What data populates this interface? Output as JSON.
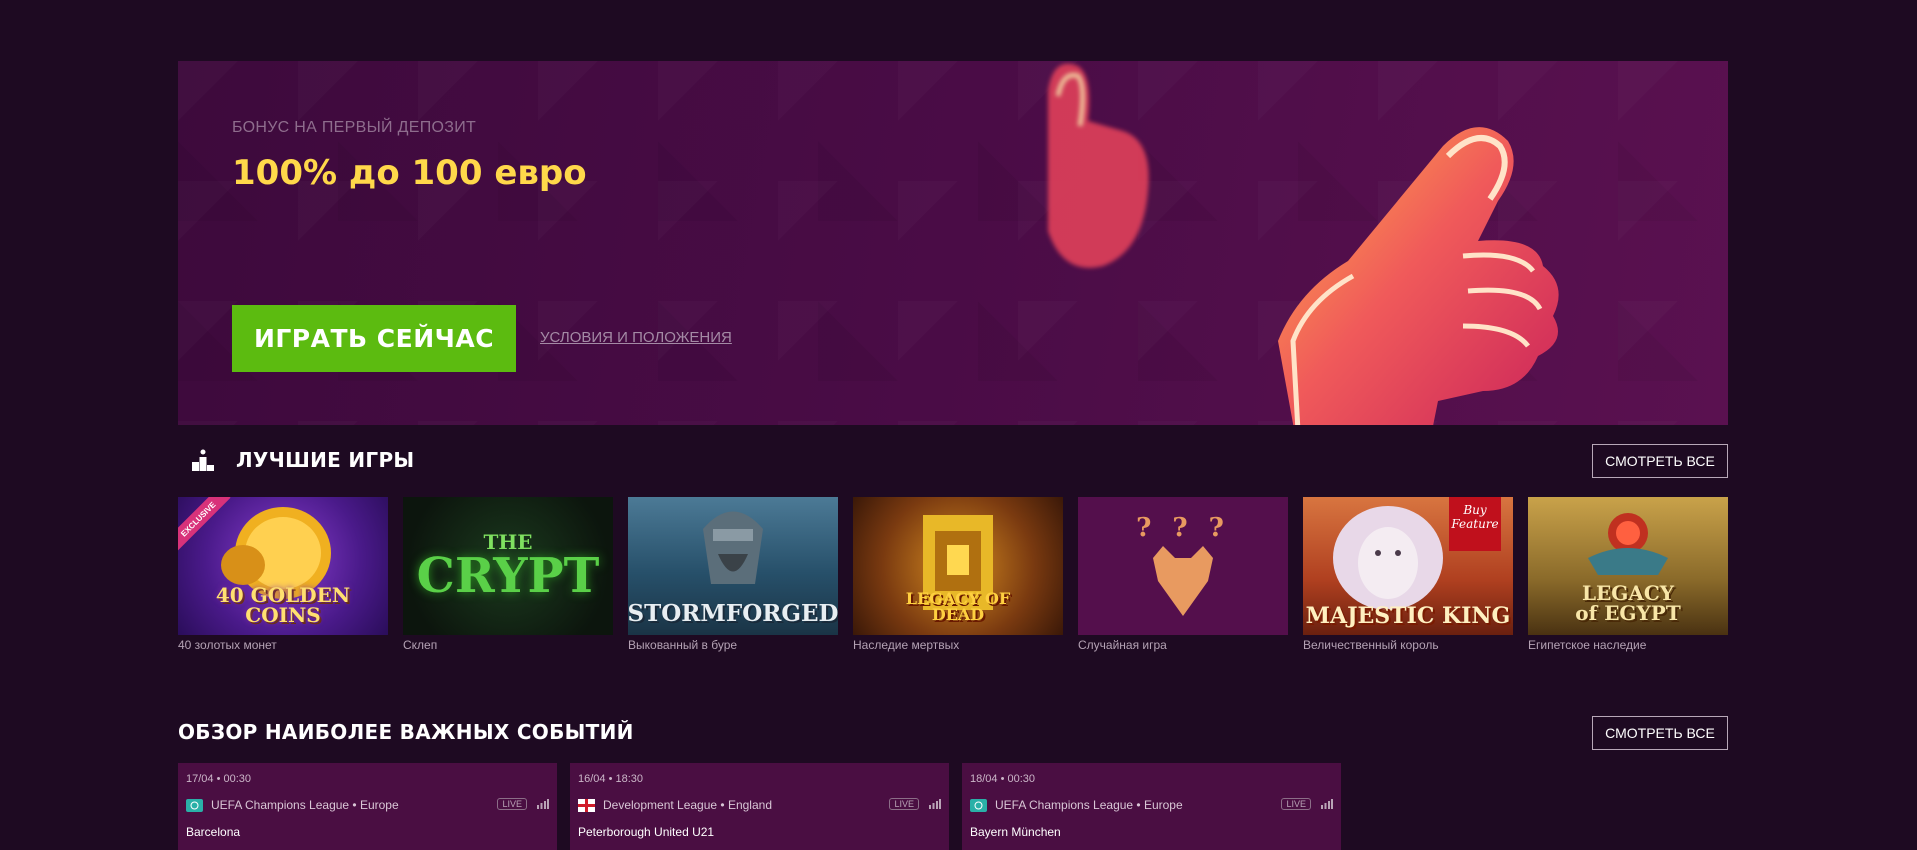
{
  "hero": {
    "subtitle": "БОНУС НА ПЕРВЫЙ ДЕПОЗИТ",
    "title": "100% до 100 евро",
    "play_label": "ИГРАТЬ СЕЙЧАС",
    "terms_label": "УСЛОВИЯ И ПОЛОЖЕНИЯ",
    "accent_color": "#ffd84a",
    "button_color": "#5cbb10"
  },
  "top_games": {
    "title": "ЛУЧШИЕ ИГРЫ",
    "see_all": "СМОТРЕТЬ ВСЕ",
    "games": [
      {
        "name": "40 золотых монет",
        "thumb_text": "40 GOLDEN COINS",
        "badge": "EXCLUSIVE"
      },
      {
        "name": "Склеп",
        "thumb_text_small": "THE",
        "thumb_text": "CRYPT"
      },
      {
        "name": "Выкованный в буре",
        "thumb_text": "STORMFORGED"
      },
      {
        "name": "Наследие мертвых",
        "thumb_text": "LEGACY OF DEAD"
      },
      {
        "name": "Случайная игра",
        "thumb_text": "? ? ?"
      },
      {
        "name": "Величественный король",
        "thumb_text": "MAJESTIC KING",
        "badge": "Buy Feature"
      },
      {
        "name": "Египетское наследие",
        "thumb_text": "LEGACY of EGYPT"
      }
    ]
  },
  "events": {
    "title": "ОБЗОР НАИБОЛЕЕ ВАЖНЫХ СОБЫТИЙ",
    "see_all": "СМОТРЕТЬ ВСЕ",
    "live_label": "LIVE",
    "items": [
      {
        "date": "17/04 • 00:30",
        "league": "UEFA Champions League • Europe",
        "team": "Barcelona",
        "flag": "europe"
      },
      {
        "date": "16/04 • 18:30",
        "league": "Development League • England",
        "team": "Peterborough United U21",
        "flag": "england"
      },
      {
        "date": "18/04 • 00:30",
        "league": "UEFA Champions League • Europe",
        "team": "Bayern München",
        "flag": "europe"
      }
    ]
  }
}
